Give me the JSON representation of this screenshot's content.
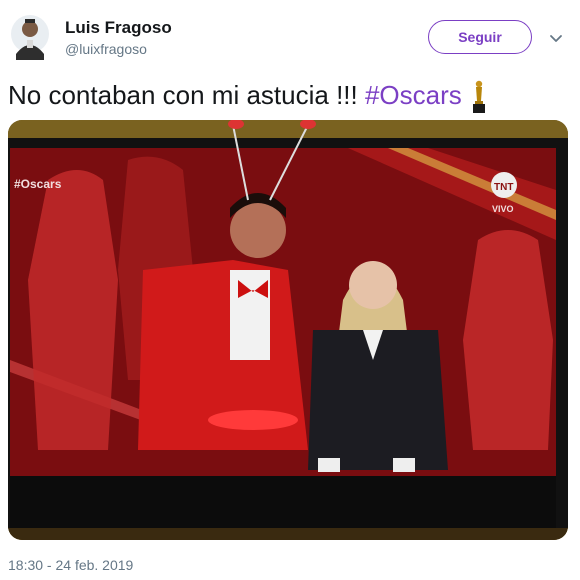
{
  "user": {
    "name": "Luis Fragoso",
    "handle": "@luixfragoso"
  },
  "follow_label": "Seguir",
  "tweet": {
    "text": "No contaban con mi astucia !!! ",
    "hashtag": "#Oscars"
  },
  "media": {
    "overlay_tag": "#Oscars",
    "channel_label": "VIVO"
  },
  "timestamp": "18:30 - 24 feb. 2019",
  "colors": {
    "accent": "#7b3fc4",
    "secondary_text": "#657786",
    "primary_text": "#14171a"
  },
  "icons": {
    "avatar": "user-avatar",
    "caret": "chevron-down-icon",
    "trophy": "oscar-trophy-icon",
    "channel_logo": "tnt-logo"
  }
}
